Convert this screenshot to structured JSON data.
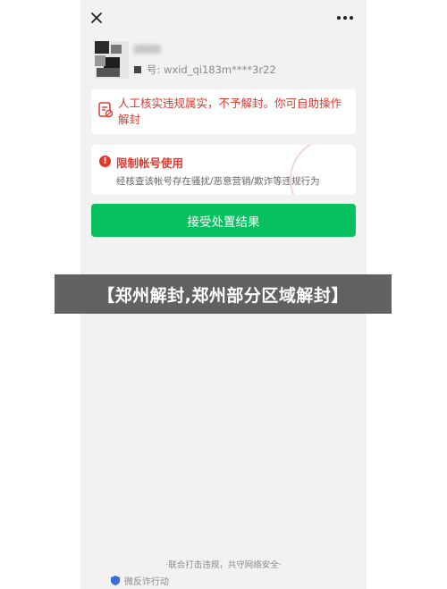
{
  "topbar": {
    "close_icon": "close-icon",
    "more_icon": "more-dots-icon"
  },
  "profile": {
    "wxid": "号: wxid_qi183m****3r22"
  },
  "notice": {
    "text": "人工核实违规属实，不予解封。你可自助操作解封",
    "icon": "account-lock-icon",
    "color": "#e0382f"
  },
  "restriction": {
    "icon": "alert-icon",
    "title": "限制帐号使用",
    "description": "经核查该帐号存在骚扰/恶意营销/欺诈等违规行为"
  },
  "accept_button": {
    "label": "接受处置结果",
    "color": "#07c160"
  },
  "banner": {
    "text": "【郑州解封,郑州部分区域解封】"
  },
  "footer": {
    "line": "·联合打击违规，共守网络安全·",
    "brand": "微反诈行动",
    "brand_icon": "shield-icon"
  }
}
